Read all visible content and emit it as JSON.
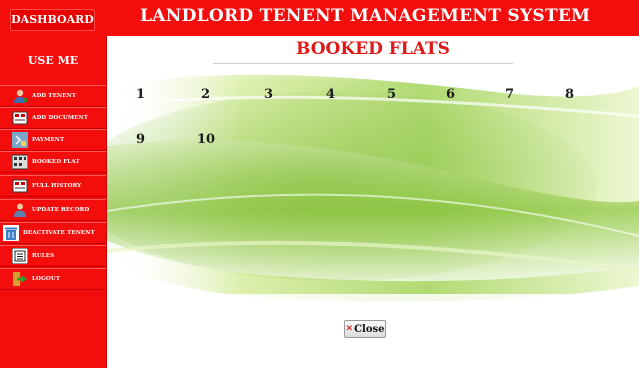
{
  "header": {
    "dashboard_label": "DASHBOARD",
    "title": "LANDLORD TENENT MANAGEMENT SYSTEM"
  },
  "sidebar": {
    "heading": "USE ME",
    "items": [
      {
        "label": "ADD TENENT",
        "icon": "user-icon"
      },
      {
        "label": "ADD DOCUMENT",
        "icon": "document-icon"
      },
      {
        "label": "PAYMENT",
        "icon": "payment-icon"
      },
      {
        "label": "BOOKED FLAT",
        "icon": "building-icon"
      },
      {
        "label": "FULL HISTORY",
        "icon": "history-icon"
      },
      {
        "label": "UPDATE RECORD",
        "icon": "update-user-icon"
      },
      {
        "label": "DEACTIVATE TENENT",
        "icon": "trash-icon"
      },
      {
        "label": "RULES",
        "icon": "rules-icon"
      },
      {
        "label": "LOGOUT",
        "icon": "logout-icon"
      }
    ]
  },
  "main": {
    "title": "BOOKED FLATS",
    "flats": [
      "1",
      "2",
      "3",
      "4",
      "5",
      "6",
      "7",
      "8",
      "9",
      "10"
    ],
    "close_label": "Close"
  },
  "colors": {
    "accent": "#f40d0d",
    "title": "#e01818"
  }
}
